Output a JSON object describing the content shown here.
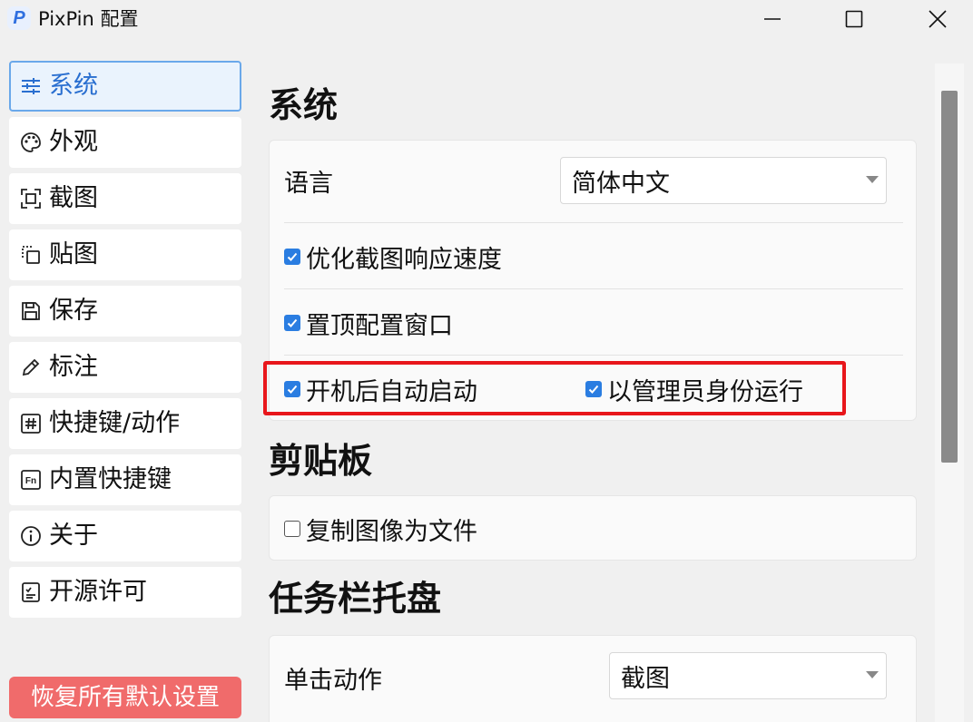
{
  "window": {
    "logo_letter": "P",
    "title": "PixPin 配置"
  },
  "sidebar": {
    "items": [
      {
        "label": "系统",
        "icon": "sliders-icon",
        "active": true
      },
      {
        "label": "外观",
        "icon": "palette-icon"
      },
      {
        "label": "截图",
        "icon": "screenshot-frame-icon"
      },
      {
        "label": "贴图",
        "icon": "pin-copy-icon"
      },
      {
        "label": "保存",
        "icon": "save-icon"
      },
      {
        "label": "标注",
        "icon": "pencil-icon"
      },
      {
        "label": "快捷键/动作",
        "icon": "hash-key-icon"
      },
      {
        "label": "内置快捷键",
        "icon": "fn-key-icon"
      },
      {
        "label": "关于",
        "icon": "info-icon"
      },
      {
        "label": "开源许可",
        "icon": "license-icon"
      }
    ],
    "reset_label": "恢复所有默认设置"
  },
  "sections": {
    "system": {
      "title": "系统",
      "language_label": "语言",
      "language_value": "简体中文",
      "optimize_label": "优化截图响应速度",
      "optimize_checked": true,
      "ontop_label": "置顶配置窗口",
      "ontop_checked": true,
      "autostart_label": "开机后自动启动",
      "autostart_checked": true,
      "admin_label": "以管理员身份运行",
      "admin_checked": true
    },
    "clipboard": {
      "title": "剪贴板",
      "copy_as_file_label": "复制图像为文件",
      "copy_as_file_checked": false
    },
    "tray": {
      "title": "任务栏托盘",
      "click_action_label": "单击动作",
      "click_action_value": "截图"
    }
  },
  "colors": {
    "accent": "#2a7de1",
    "highlight": "#e8161b",
    "reset_button": "#f06b6b"
  }
}
